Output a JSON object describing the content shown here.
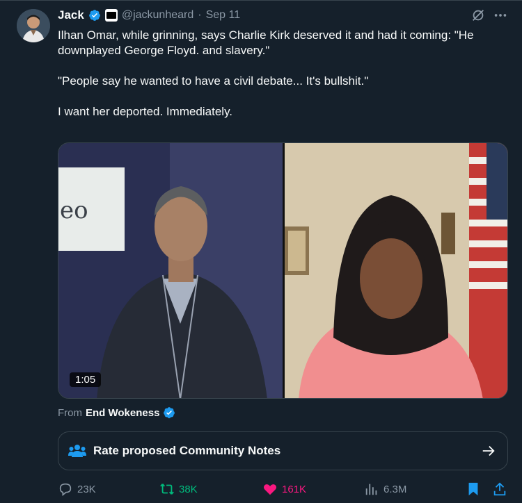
{
  "author": {
    "name": "Jack",
    "handle": "@jackunheard",
    "separator": "·",
    "date": "Sep 11"
  },
  "tweet": {
    "lines": [
      "Ilhan Omar, while grinning, says Charlie Kirk deserved it and had it coming: \"He downplayed George Floyd. and slavery.\"",
      "\"People say he wanted to have a civil debate... It's bullshit.\"",
      "I want her deported. Immediately."
    ]
  },
  "media": {
    "duration": "1:05",
    "left_panel_text": "eo"
  },
  "source": {
    "prefix": "From",
    "name": "End Wokeness"
  },
  "community_notes": {
    "label": "Rate proposed Community Notes"
  },
  "actions": {
    "replies": "23K",
    "reposts": "38K",
    "likes": "161K",
    "views": "6.3M"
  },
  "colors": {
    "background": "#15202b",
    "verified": "#1d9bf0",
    "repost": "#00ba7c",
    "like": "#f91880",
    "muted": "#8b98a5"
  },
  "icons": [
    "verified-badge-icon",
    "affiliate-badge-icon",
    "grok-icon",
    "more-icon",
    "community-notes-icon",
    "arrow-right-icon",
    "reply-icon",
    "repost-icon",
    "like-icon",
    "views-icon",
    "bookmark-icon",
    "share-icon"
  ]
}
